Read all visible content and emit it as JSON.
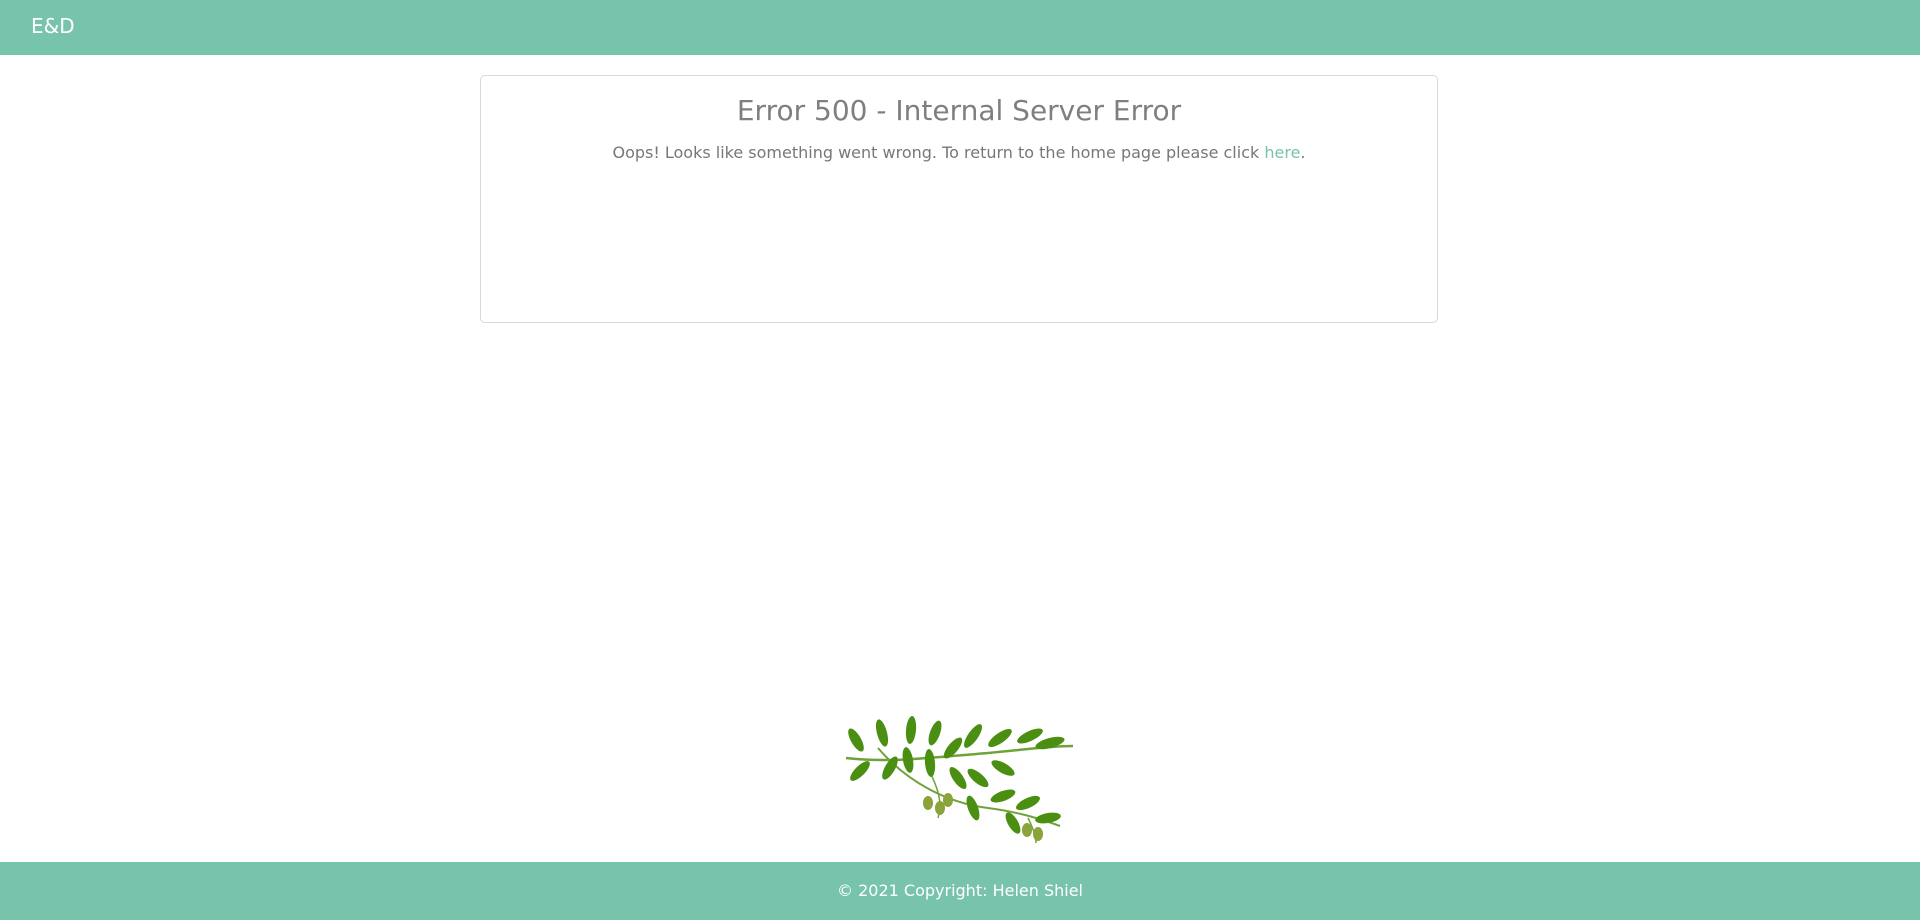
{
  "navbar": {
    "brand": "E&D"
  },
  "error_card": {
    "title": "Error 500 - Internal Server Error",
    "message_prefix": "Oops! Looks like something went wrong. To return to the home page please click",
    "link_text": "here",
    "message_suffix": "."
  },
  "decoration": {
    "icon": "olive-branch-icon"
  },
  "footer": {
    "copyright": "© 2021 Copyright: Helen Shiel"
  },
  "colors": {
    "accent": "#77c3ac",
    "text_muted": "#7f7f7f",
    "leaf": "#4a8f12",
    "olive": "#8aa33a"
  }
}
